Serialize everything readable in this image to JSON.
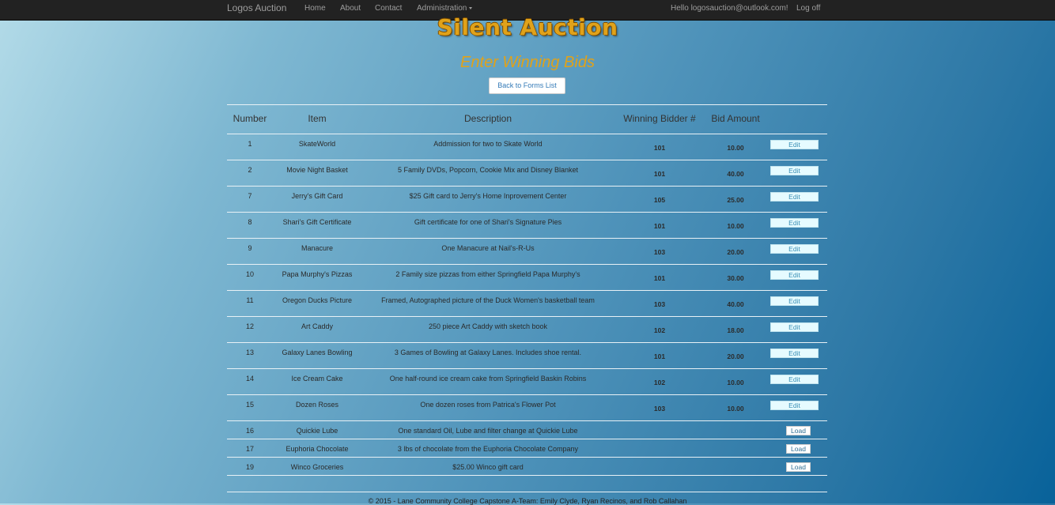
{
  "navbar": {
    "brand": "Logos Auction",
    "items": [
      "Home",
      "About",
      "Contact",
      "Administration"
    ],
    "greeting": "Hello logosauction@outlook.com!",
    "logoff": "Log off"
  },
  "page": {
    "title": "Silent Auction",
    "subtitle": "Enter Winning Bids",
    "back_button": "Back to Forms List"
  },
  "table": {
    "headers": [
      "Number",
      "Item",
      "Description",
      "Winning Bidder #",
      "Bid Amount"
    ],
    "rows": [
      {
        "number": "1",
        "item": "SkateWorld",
        "description": "Addmission for two to Skate World",
        "bidder": "101",
        "amount": "10.00",
        "action": "Edit"
      },
      {
        "number": "2",
        "item": "Movie Night Basket",
        "description": "5 Family DVDs, Popcorn, Cookie Mix and Disney Blanket",
        "bidder": "101",
        "amount": "40.00",
        "action": "Edit"
      },
      {
        "number": "7",
        "item": "Jerry's Gift Card",
        "description": "$25 Gift card to Jerry's Home Inprovement Center",
        "bidder": "105",
        "amount": "25.00",
        "action": "Edit"
      },
      {
        "number": "8",
        "item": "Shari's Gift Certificate",
        "description": "Gift certificate for one of Shari's Signature Pies",
        "bidder": "101",
        "amount": "10.00",
        "action": "Edit"
      },
      {
        "number": "9",
        "item": "Manacure",
        "description": "One Manacure at Nail's-R-Us",
        "bidder": "103",
        "amount": "20.00",
        "action": "Edit"
      },
      {
        "number": "10",
        "item": "Papa Murphy's Pizzas",
        "description": "2 Family size pizzas from either Springfield Papa Murphy's",
        "bidder": "101",
        "amount": "30.00",
        "action": "Edit"
      },
      {
        "number": "11",
        "item": "Oregon Ducks Picture",
        "description": "Framed, Autographed picture of the Duck Women's basketball team",
        "bidder": "103",
        "amount": "40.00",
        "action": "Edit"
      },
      {
        "number": "12",
        "item": "Art Caddy",
        "description": "250 piece Art Caddy with sketch book",
        "bidder": "102",
        "amount": "18.00",
        "action": "Edit"
      },
      {
        "number": "13",
        "item": "Galaxy Lanes Bowling",
        "description": "3 Games of Bowling at Galaxy Lanes. Includes shoe rental.",
        "bidder": "101",
        "amount": "20.00",
        "action": "Edit"
      },
      {
        "number": "14",
        "item": "Ice Cream Cake",
        "description": "One half-round ice cream cake from Springfield Baskin Robins",
        "bidder": "102",
        "amount": "10.00",
        "action": "Edit"
      },
      {
        "number": "15",
        "item": "Dozen Roses",
        "description": "One dozen roses from Patrica's Flower Pot",
        "bidder": "103",
        "amount": "10.00",
        "action": "Edit"
      },
      {
        "number": "16",
        "item": "Quickie Lube",
        "description": "One standard Oil, Lube and filter change at Quickie Lube",
        "bidder": "",
        "amount": "",
        "action": "Load"
      },
      {
        "number": "17",
        "item": "Euphoria Chocolate",
        "description": "3 lbs of chocolate from the Euphoria Chocolate Company",
        "bidder": "",
        "amount": "",
        "action": "Load"
      },
      {
        "number": "19",
        "item": "Winco Groceries",
        "description": "$25.00 Winco gift card",
        "bidder": "",
        "amount": "",
        "action": "Load"
      }
    ]
  },
  "footer": "© 2015 - Lane Community College Capstone A-Team: Emily Clyde, Ryan Recinos, and Rob Callahan"
}
